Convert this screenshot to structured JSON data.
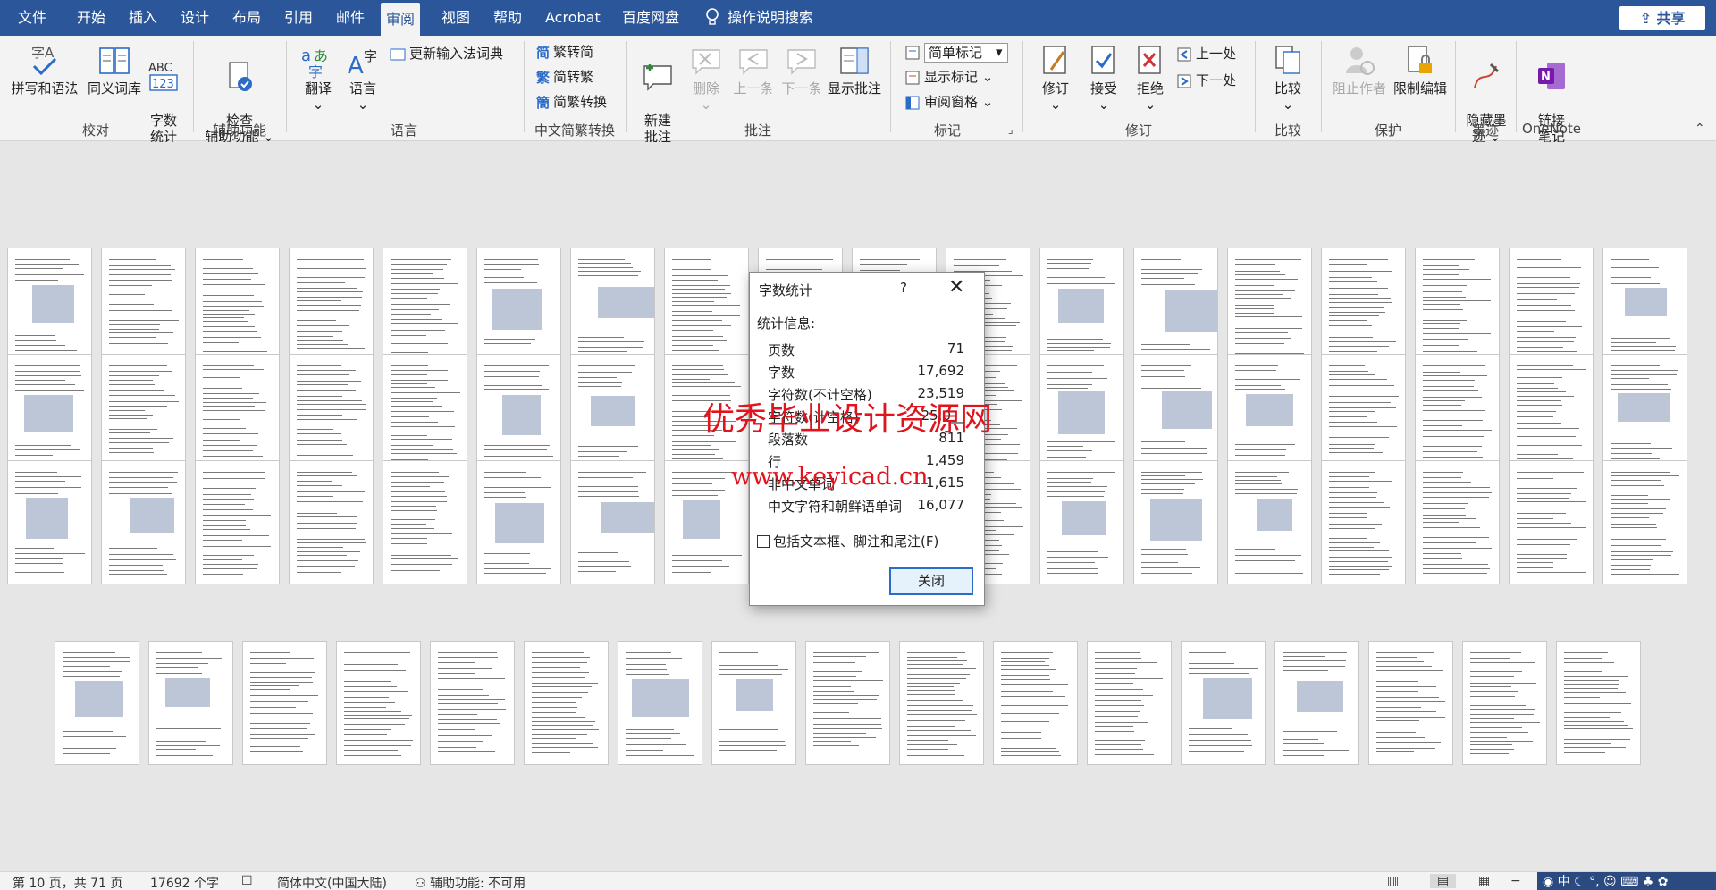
{
  "menubar": {
    "tabs": [
      "文件",
      "开始",
      "插入",
      "设计",
      "布局",
      "引用",
      "邮件",
      "审阅",
      "视图",
      "帮助",
      "Acrobat",
      "百度网盘"
    ],
    "active_tab": "审阅",
    "search": "操作说明搜索",
    "share": "共享"
  },
  "ribbon": {
    "proofing": {
      "spelling": "拼写和语法",
      "thesaurus": "同义词库",
      "wordcount": "字数\n统计",
      "label": "校对"
    },
    "accessibility": {
      "check": "检查\n辅助功能",
      "label": "辅助功能"
    },
    "language": {
      "translate": "翻译",
      "language": "语言",
      "update_ime": "更新输入法词典",
      "label": "语言"
    },
    "chinese": {
      "to_simplified": "繁转简",
      "to_traditional": "简转繁",
      "convert": "简繁转换",
      "label": "中文简繁转换"
    },
    "comments": {
      "new": "新建\n批注",
      "delete": "删除",
      "prev": "上一条",
      "next": "下一条",
      "show": "显示批注",
      "label": "批注"
    },
    "tracking": {
      "markup_select": "简单标记",
      "show_markup": "显示标记",
      "review_pane": "审阅窗格",
      "label": "标记"
    },
    "changes": {
      "track": "修订",
      "accept": "接受",
      "reject": "拒绝",
      "prev": "上一处",
      "next": "下一处",
      "label": "修订"
    },
    "compare": {
      "compare": "比较",
      "label": "比较"
    },
    "protect": {
      "block_authors": "阻止作者",
      "restrict": "限制编辑",
      "label": "保护"
    },
    "ink": {
      "hide_ink": "隐藏墨\n迹",
      "label": "墨迹"
    },
    "onenote": {
      "linked_notes": "链接\n笔记",
      "label": "OneNote"
    }
  },
  "dialog": {
    "title": "字数统计",
    "help": "?",
    "info_label": "统计信息:",
    "stats": [
      {
        "k": "页数",
        "v": "71"
      },
      {
        "k": "字数",
        "v": "17,692"
      },
      {
        "k": "字符数(不计空格)",
        "v": "23,519"
      },
      {
        "k": "字符数(计空格)",
        "v": "25,0__"
      },
      {
        "k": "段落数",
        "v": "811"
      },
      {
        "k": "行",
        "v": "1,459"
      },
      {
        "k": "非中文单词",
        "v": "1,615"
      },
      {
        "k": "中文字符和朝鲜语单词",
        "v": "16,077"
      }
    ],
    "include_label": "包括文本框、脚注和尾注(F)",
    "close": "关闭"
  },
  "watermark": {
    "line1": "优秀毕业设计资源网",
    "line2": "www.keyicad.cn"
  },
  "status": {
    "page": "第 10 页，共 71 页",
    "words": "17692 个字",
    "language": "简体中文(中国大陆)",
    "accessibility": "辅助功能: 不可用"
  },
  "colors": {
    "brand": "#2b579a",
    "watermark": "#e1141e"
  }
}
